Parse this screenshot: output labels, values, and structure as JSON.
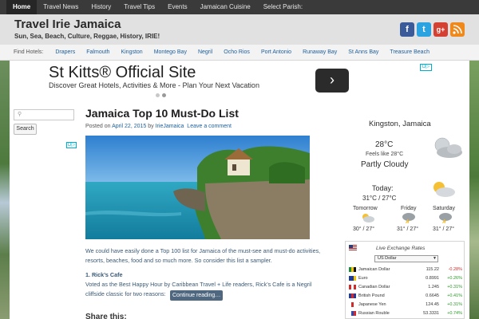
{
  "topnav": {
    "items": [
      {
        "label": "Home",
        "active": true
      },
      {
        "label": "Travel News"
      },
      {
        "label": "History"
      },
      {
        "label": "Travel Tips"
      },
      {
        "label": "Events"
      },
      {
        "label": "Jamaican Cuisine"
      },
      {
        "label": "Select Parish:"
      }
    ]
  },
  "header": {
    "title": "Travel Irie Jamaica",
    "tagline": "Sun, Sea, Beach, Culture, Reggae, History, IRIE!",
    "social": [
      "facebook-icon",
      "twitter-icon",
      "google-plus-icon",
      "rss-icon"
    ]
  },
  "parish_bar": {
    "label": "Find Hotels:",
    "items": [
      "Drapers",
      "Falmouth",
      "Kingston",
      "Montego Bay",
      "Negril",
      "Ocho Rios",
      "Port Antonio",
      "Runaway Bay",
      "St Anns Bay",
      "Treasure Beach"
    ]
  },
  "ad": {
    "title": "St Kitts® Official Site",
    "subtitle": "Discover Great Hotels, Activities & More - Plan Your Next Vacation",
    "next_label": "›",
    "adchoice": "D▷"
  },
  "sidebar": {
    "search_placeholder": "⚲",
    "search_button": "Search",
    "adchoice": "D▷"
  },
  "article": {
    "title": "Jamaica Top 10 Must-Do List",
    "meta_prefix": "Posted on",
    "date": "April 22, 2015",
    "by": "by",
    "author": "IrieJamaica",
    "comment_link": "Leave a comment",
    "intro": "We could have easily done a Top 100 list for Jamaica of the must-see and must-do activities, resorts, beaches, food and so much more. So consider this list a sampler.",
    "section_heading": "1. Rick’s Cafe",
    "section_text": "Voted as the Best Happy Hour by Caribbean Travel + Life readers, Rick’s Cafe is a Negril cliffside classic for two reasons:",
    "continue_label": "Continue reading…",
    "share_title": "Share this:"
  },
  "weather": {
    "city": "Kingston, Jamaica",
    "temp": "28°C",
    "feels_like": "Feels like 28°C",
    "condition": "Partly Cloudy",
    "today_label": "Today:",
    "today_temps": "31°C / 27°C",
    "forecast": [
      {
        "day": "Tomorrow",
        "temps": "30° / 27°"
      },
      {
        "day": "Friday",
        "temps": "31° / 27°"
      },
      {
        "day": "Saturday",
        "temps": "31° / 27°"
      }
    ]
  },
  "exchange": {
    "title": "Live Exchange Rates",
    "selected_currency": "US Dollar",
    "rows": [
      {
        "name": "Jamaican Dollar",
        "rate": "115.22",
        "change": "-0.28%",
        "dir": "dn",
        "flag": [
          "#1a8c3a",
          "#f3c400",
          "#111"
        ]
      },
      {
        "name": "Euro",
        "rate": "0.8991",
        "change": "+0.26%",
        "dir": "up",
        "flag": [
          "#1f3c9a",
          "#1f3c9a",
          "#f3c400"
        ]
      },
      {
        "name": "Canadian Dollar",
        "rate": "1.245",
        "change": "+0.31%",
        "dir": "up",
        "flag": [
          "#d42a2a",
          "#fff",
          "#d42a2a"
        ]
      },
      {
        "name": "British Pound",
        "rate": "0.6645",
        "change": "+0.41%",
        "dir": "up",
        "flag": [
          "#1f3c9a",
          "#d42a2a",
          "#1f3c9a"
        ]
      },
      {
        "name": "Japanese Yen",
        "rate": "124.45",
        "change": "+0.31%",
        "dir": "up",
        "flag": [
          "#fff",
          "#d42a2a",
          "#fff"
        ]
      },
      {
        "name": "Russian Rouble",
        "rate": "53.3331",
        "change": "+0.74%",
        "dir": "up",
        "flag": [
          "#fff",
          "#2a4bb0",
          "#d42a2a"
        ]
      }
    ]
  }
}
